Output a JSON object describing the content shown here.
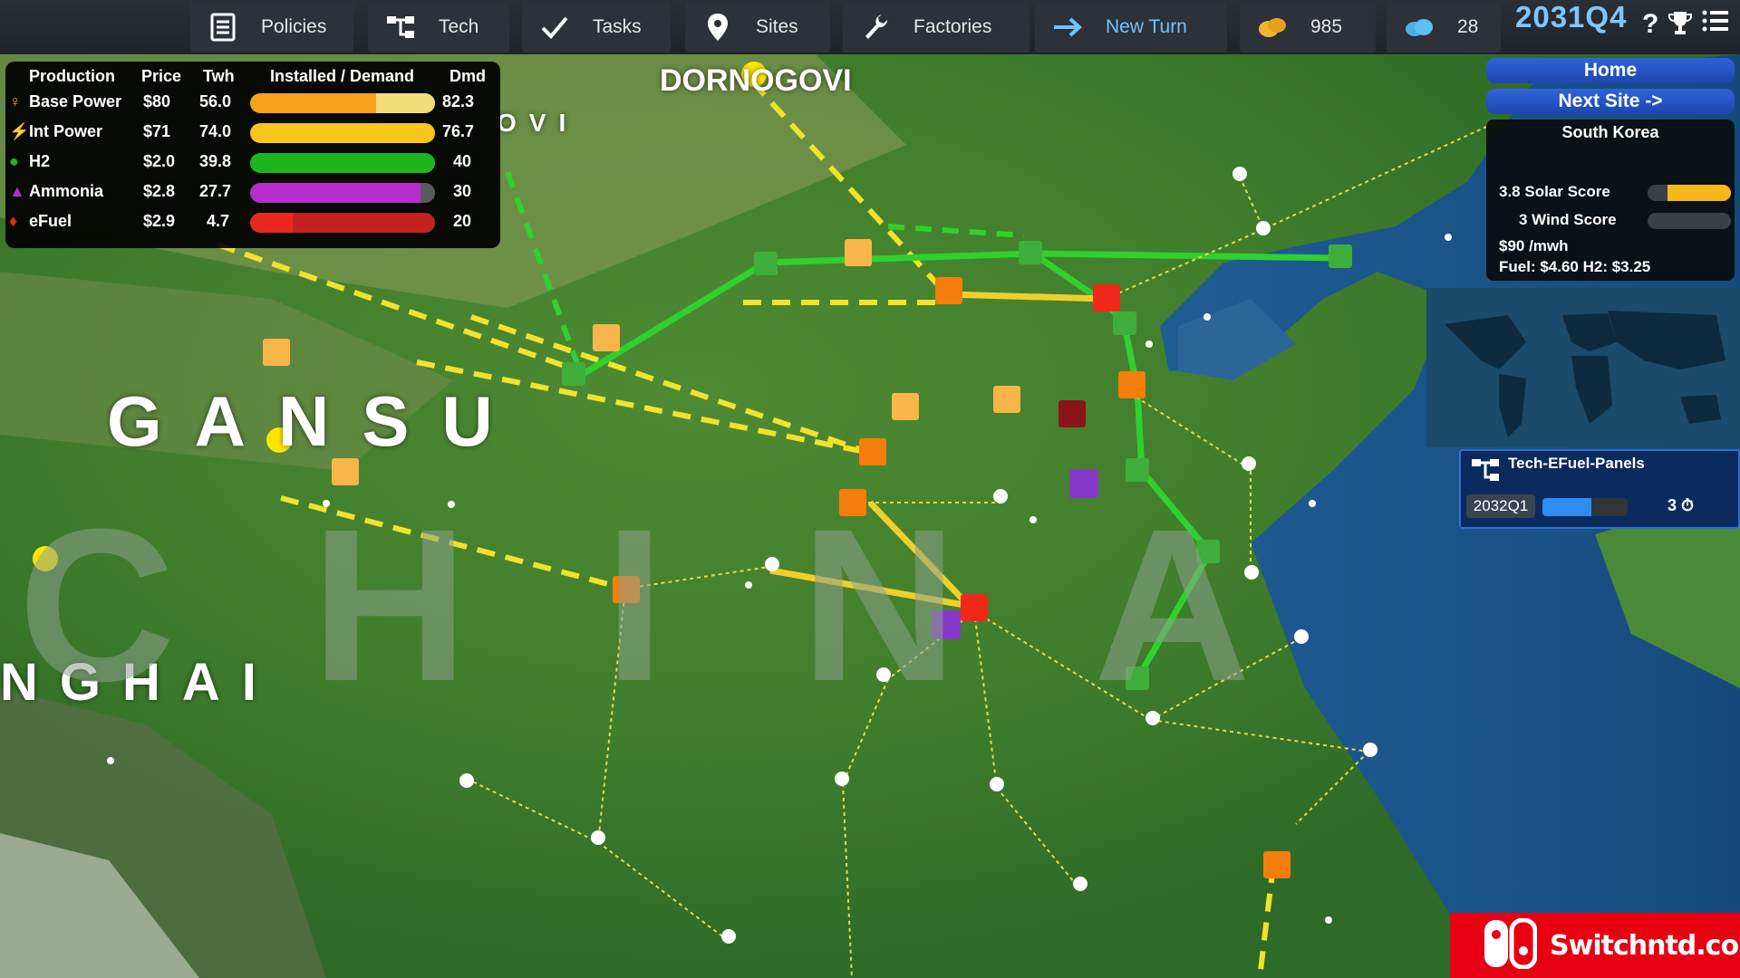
{
  "toolbar": {
    "buttons": [
      {
        "label": "Policies",
        "icon": "clipboard-icon"
      },
      {
        "label": "Tech",
        "icon": "tech-tree-icon"
      },
      {
        "label": "Tasks",
        "icon": "checkmark-icon"
      },
      {
        "label": "Sites",
        "icon": "map-pin-icon"
      },
      {
        "label": "Factories",
        "icon": "wrench-icon"
      },
      {
        "label": "New Turn",
        "icon": "arrow-right-icon"
      }
    ],
    "money": "985",
    "carbon": "28",
    "date": "2031Q4",
    "help_label": "?"
  },
  "production": {
    "headers": {
      "production": "Production",
      "price": "Price",
      "twh": "Twh",
      "installed": "Installed / Demand",
      "dmd": "Dmd"
    },
    "rows": [
      {
        "name": "Base Power",
        "price": "$80",
        "twh": "56.0",
        "dmd": "82.3",
        "installed_frac": 0.68,
        "demand_frac": 1.0,
        "color": "#f7a21b",
        "icon": "base-power-icon"
      },
      {
        "name": "Int Power",
        "price": "$71",
        "twh": "74.0",
        "dmd": "76.7",
        "installed_frac": 0.97,
        "demand_frac": 1.0,
        "color": "#f7c51b",
        "icon": "lightning-icon"
      },
      {
        "name": "H2",
        "price": "$2.0",
        "twh": "39.8",
        "dmd": "40",
        "installed_frac": 1.0,
        "demand_frac": 1.0,
        "color": "#1fb51f",
        "icon": "h2-drop-icon"
      },
      {
        "name": "Ammonia",
        "price": "$2.8",
        "twh": "27.7",
        "dmd": "30",
        "installed_frac": 0.92,
        "demand_frac": 1.0,
        "color": "#b72ccf",
        "icon": "ammonia-flask-icon"
      },
      {
        "name": "eFuel",
        "price": "$2.9",
        "twh": "4.7",
        "dmd": "20",
        "installed_frac": 0.23,
        "demand_frac": 1.0,
        "color": "#e8281f",
        "icon": "flame-icon"
      }
    ]
  },
  "nav": {
    "home": "Home",
    "next_site": "Next Site ->"
  },
  "site_info": {
    "country": "South Korea",
    "solar_score": "3.8 Solar Score",
    "solar_frac": 0.76,
    "wind_score": "3 Wind Score",
    "wind_frac": 0.0,
    "price": "$90 /mwh",
    "fuel": "Fuel: $4.60 H2: $3.25"
  },
  "research": {
    "name": "Tech-EFuel-Panels",
    "date": "2032Q1",
    "progress": 0.57,
    "turns": "3"
  },
  "map_labels": {
    "gansu": "GANSU",
    "china": "CHINA",
    "qinghai": "NGHAI",
    "dornogovi": "DORNOGOVI",
    "ovi": "OVI"
  },
  "watermark": "Switchntd.com",
  "colors": {
    "green_pipe": "#2ed12e",
    "yellow_line": "#f2e22b",
    "accent": "#7fc6ff"
  }
}
